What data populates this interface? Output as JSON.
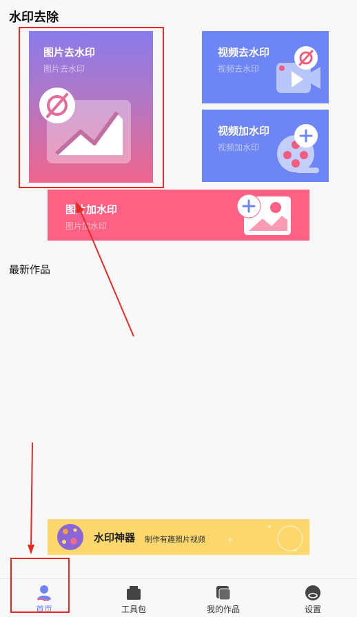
{
  "page": {
    "title": "水印去除"
  },
  "cards": {
    "image_remove": {
      "title": "图片去水印",
      "subtitle": "图片去水印"
    },
    "video_remove": {
      "title": "视频去水印",
      "subtitle": "视频去水印"
    },
    "video_add": {
      "title": "视频加水印",
      "subtitle": "视频加水印"
    },
    "image_add": {
      "title": "图片加水印",
      "subtitle": "图片加水印"
    }
  },
  "section": {
    "latest": "最新作品"
  },
  "banner": {
    "title": "水印神器",
    "subtitle": "制作有趣照片视频"
  },
  "tabbar": {
    "items": [
      {
        "label": "首页",
        "icon": "user-icon",
        "active": true
      },
      {
        "label": "工具包",
        "icon": "toolbox-icon",
        "active": false
      },
      {
        "label": "我的作品",
        "icon": "works-icon",
        "active": false
      },
      {
        "label": "设置",
        "icon": "settings-icon",
        "active": false
      }
    ]
  },
  "colors": {
    "accent": "#6e86f5",
    "pink": "#fe6184",
    "banner": "#fbd76d",
    "annotation": "#e52a24"
  }
}
